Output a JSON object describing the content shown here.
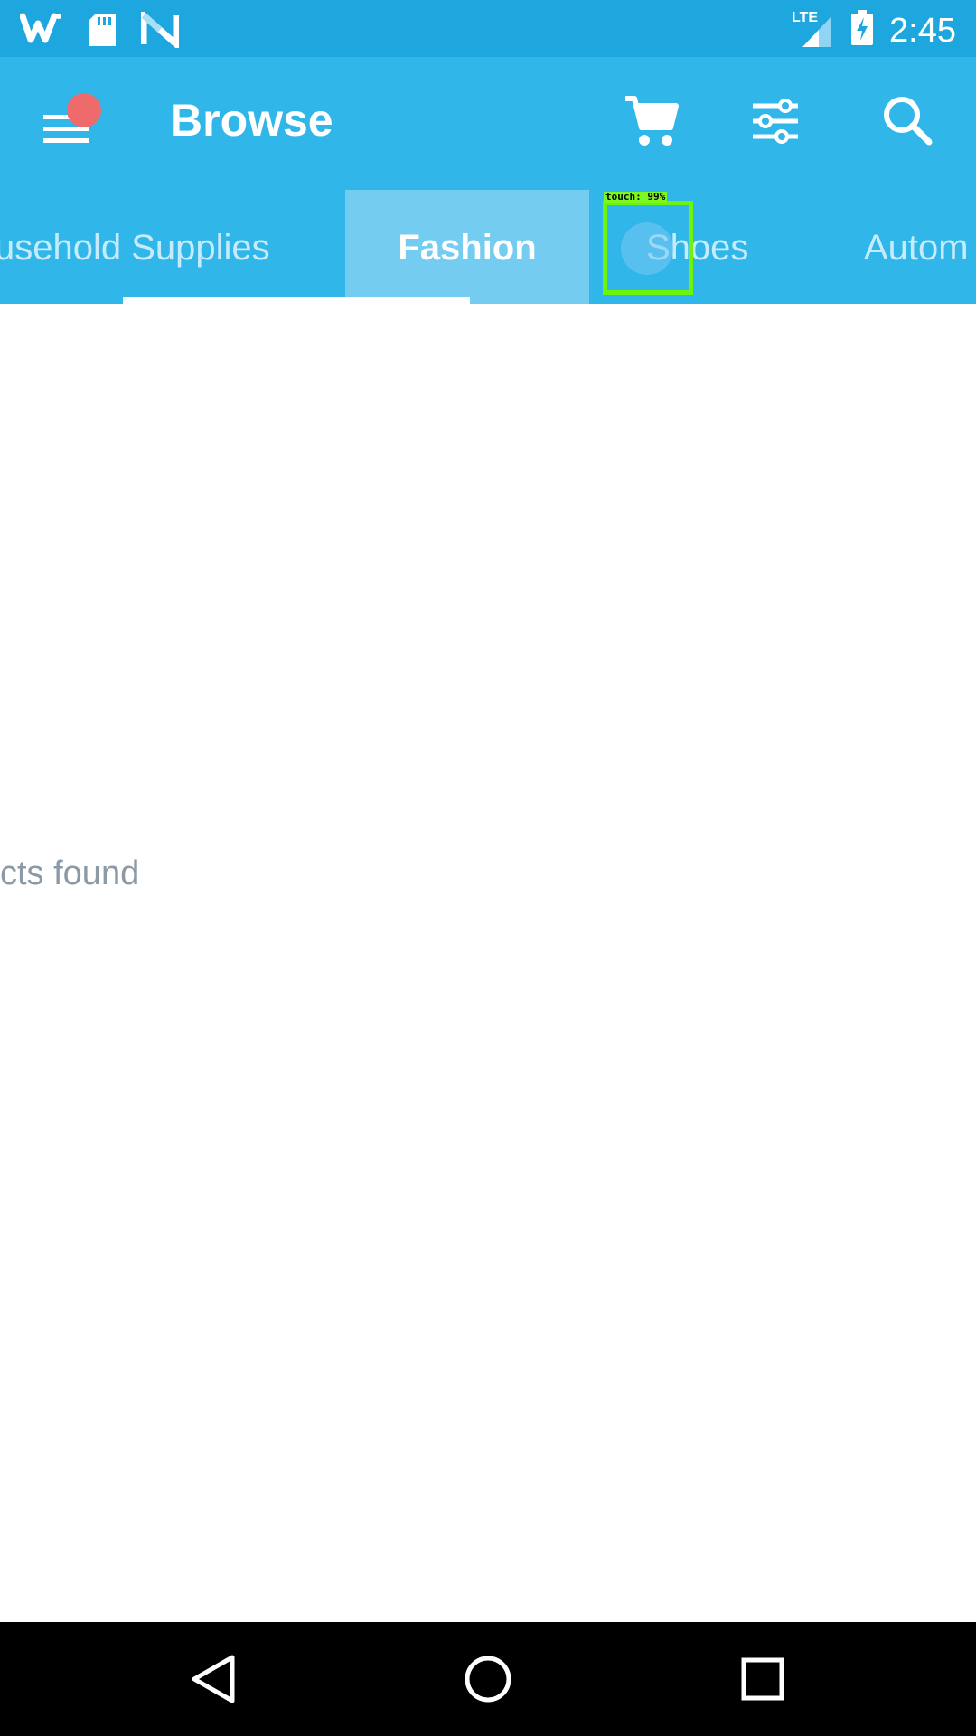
{
  "status_bar": {
    "left_icons": [
      "wish-app-icon",
      "sd-card-icon",
      "n-notification-icon"
    ],
    "network": "LTE",
    "battery": "battery-charging-icon",
    "time": "2:45"
  },
  "app_bar": {
    "title": "Browse",
    "has_notification": true,
    "actions": [
      "cart-icon",
      "filter-icon",
      "search-icon"
    ]
  },
  "tabs": [
    {
      "label": "Household Supplies",
      "visible_text": "usehold Supplies",
      "active": false
    },
    {
      "label": "Fashion",
      "active": true
    },
    {
      "label": "Shoes",
      "active": false
    },
    {
      "label": "Automotive",
      "visible_text": "Autom",
      "active": false
    }
  ],
  "overlay": {
    "touch_label": "touch: 99%"
  },
  "main": {
    "empty_message": "cts found"
  },
  "nav_bar": {
    "buttons": [
      "back-icon",
      "home-icon",
      "recents-icon"
    ]
  },
  "colors": {
    "status_bar": "#1ea7df",
    "app_bar": "#31b6ea",
    "active_tab": "#74cdf0",
    "notification_dot": "#ef6a6a",
    "touch_box": "#6ef40a"
  }
}
